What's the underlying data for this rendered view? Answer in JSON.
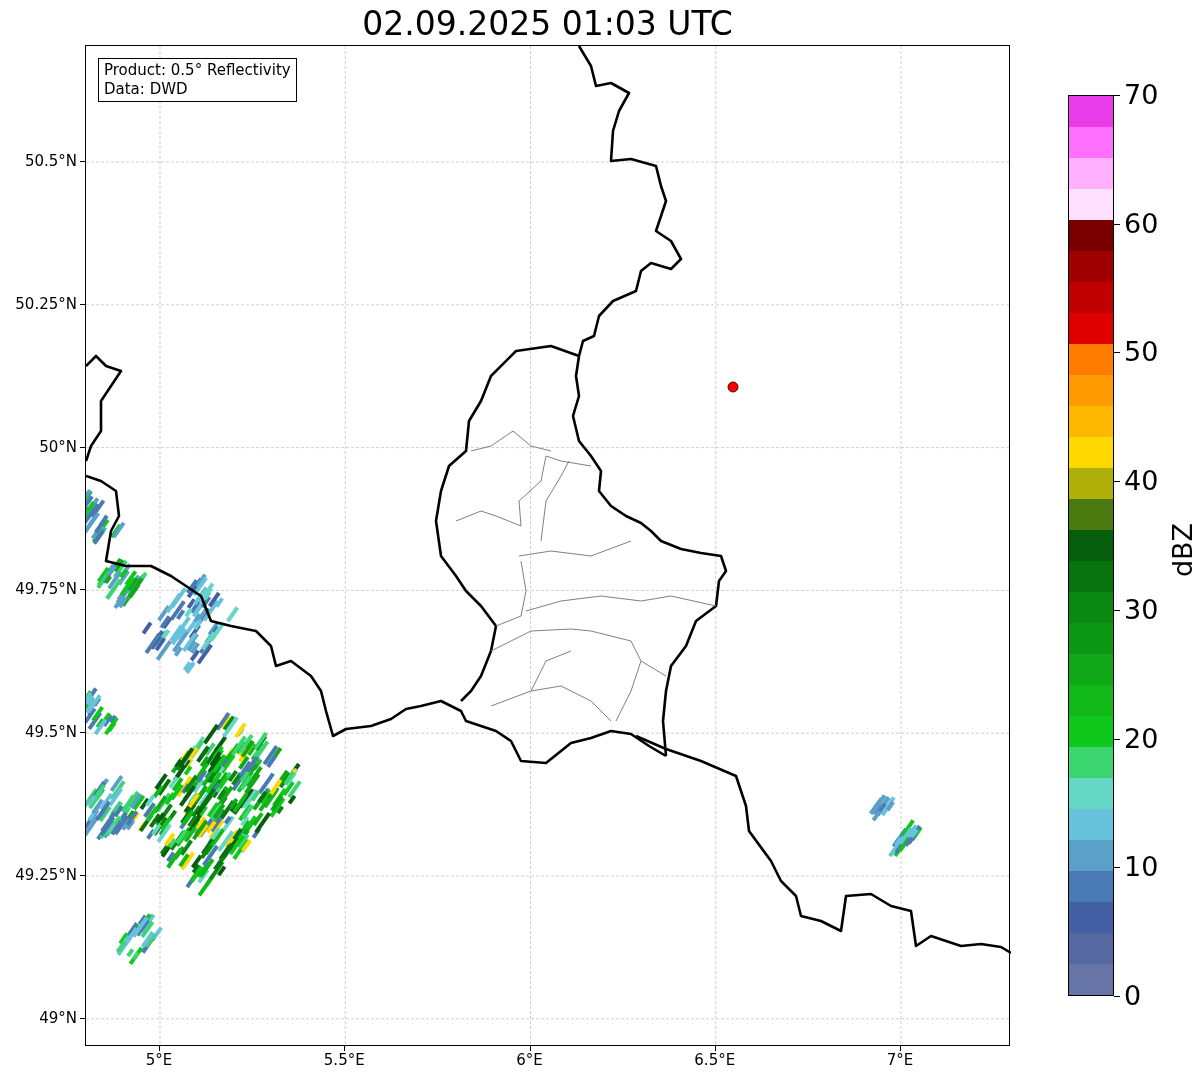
{
  "title": "02.09.2025 01:03 UTC",
  "info_box": [
    "Product: 0.5° Reflectivity",
    "Data: DWD"
  ],
  "axes": {
    "y_ticks": [
      "50.5°N",
      "50.25°N",
      "50°N",
      "49.75°N",
      "49.5°N",
      "49.25°N",
      "49°N"
    ],
    "x_ticks": [
      "5°E",
      "5.5°E",
      "6°E",
      "6.5°E",
      "7°E"
    ]
  },
  "colorbar": {
    "label": "dBZ",
    "ticks": [
      "70",
      "60",
      "50",
      "40",
      "30",
      "20",
      "10",
      "0"
    ],
    "bands": [
      {
        "color": "#e83ce8"
      },
      {
        "color": "#ff70ff"
      },
      {
        "color": "#ffb0ff"
      },
      {
        "color": "#ffe0ff"
      },
      {
        "color": "#7a0000"
      },
      {
        "color": "#a00000"
      },
      {
        "color": "#c00000"
      },
      {
        "color": "#e00000"
      },
      {
        "color": "#ff7c00"
      },
      {
        "color": "#ff9a00"
      },
      {
        "color": "#ffb800"
      },
      {
        "color": "#ffd800"
      },
      {
        "color": "#b0b00a"
      },
      {
        "color": "#4a7a10"
      },
      {
        "color": "#065e0c"
      },
      {
        "color": "#087410"
      },
      {
        "color": "#0a8812"
      },
      {
        "color": "#0c9814"
      },
      {
        "color": "#10a818"
      },
      {
        "color": "#10b818"
      },
      {
        "color": "#10c81c"
      },
      {
        "color": "#3cd670"
      },
      {
        "color": "#64d8c4"
      },
      {
        "color": "#67c3dc"
      },
      {
        "color": "#5ba0c8"
      },
      {
        "color": "#4a7ab4"
      },
      {
        "color": "#4460a4"
      },
      {
        "color": "#55689f"
      },
      {
        "color": "#6675a6"
      }
    ]
  }
}
